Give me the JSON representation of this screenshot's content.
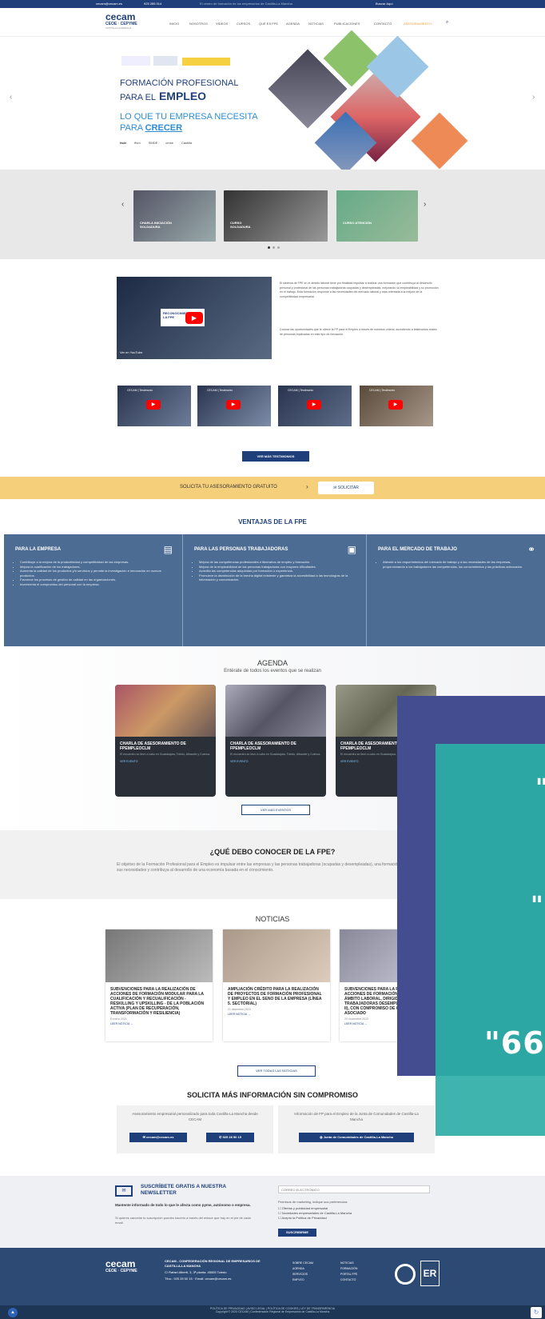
{
  "topbar": {
    "email": "cecam@cecam.es",
    "phone": "925 285 014",
    "tagline": "El centro de formación de los empresarios de Castilla-La Mancha",
    "search": "Buscar Aquí"
  },
  "header": {
    "logo_main": "cecam",
    "logo_sub": "CEOE · CEPYME",
    "logo_caption": "CASTILLA-LA MANCHA",
    "nav": [
      "INICIO",
      "NOSOTROS",
      "VÍDEOS",
      "CURSOS",
      "QUÉ ES FPE",
      "AGENDA",
      "NOTICIAS",
      "PUBLICACIONES",
      "CONTACTO",
      "ASESORAMIENTO"
    ]
  },
  "hero": {
    "line1": "FORMACIÓN PROFESIONAL",
    "line2a": "PARA EL",
    "line2b": "EMPLEO",
    "line3": "LO QUE TU EMPRESA NECESITA",
    "line4a": "PARA",
    "line4b": "CRECER",
    "partners": [
      "fade",
      "ffcm",
      "SMDE",
      "cmse",
      "Castilla"
    ]
  },
  "carousel": {
    "items": [
      "CHARLA INICIACIÓN SOLDADURA",
      "CURSO SOLDADURA",
      "CURSO ATENCIÓN"
    ]
  },
  "video": {
    "main_title": "RECONOCIMIENTO DE LA FPE",
    "watch_label": "Ver en YouTube",
    "para1": "El sistema de FPE en el ámbito laboral tiene por finalidad impulsar a realizar una formación que contribuya al desarrollo personal y profesional de las personas trabajadoras ocupadas y desempleadas, mejorando su empleabilidad y su promoción en el trabajo. Esta formación responde a las necesidades del mercado laboral y está orientada a la mejora de la competitividad empresarial.",
    "para2": "Conoce las oportunidades que te ofrece la FP para el Empleo a través de nuestros vídeos, accediendo a testimonios reales de personas implicadas en este tipo de formación.",
    "thumbs": [
      "CECAM | Testimonio",
      "CECAM | Testimonio",
      "CECAM | Testimonio",
      "CECAM | Testimonio"
    ],
    "more_button": "VER MÁS TESTIMONIOS"
  },
  "asesoramiento": {
    "label": "SOLICITA TU ASESORAMIENTO GRATUITO",
    "button": "SOLICITAR"
  },
  "ventajas": {
    "title": "VENTAJAS DE LA FPE",
    "cols": [
      {
        "title": "PARA LA EMPRESA",
        "items": [
          "Contribuye a la mejora de la productividad y competitividad de las empresas.",
          "Mejora la cualificación de los trabajadores.",
          "Aumenta la calidad de los productos y/o servicios y permite la investigación e innovación en nuevos productos.",
          "Favorece los procesos de gestión de calidad en las organizaciones.",
          "Incrementa el compromiso del personal con la empresa."
        ]
      },
      {
        "title": "PARA LAS PERSONAS TRABAJADORAS",
        "items": [
          "Mejora de las competencias profesionales e itinerarios de empleo y formación.",
          "Mejora de la empleabilidad de las personas trabajadoras con mayores dificultades.",
          "Acredita las competencias adquiridas por formación o experiencia.",
          "Promueve la disminución de la brecha digital existente y garantiza la accesibilidad a las tecnologías de la información y comunicación."
        ]
      },
      {
        "title": "PARA EL MERCADO DE TRABAJO",
        "items": [
          "Atiende a los requerimientos del mercado de trabajo y a las necesidades de las empresas, proporcionando a los trabajadores las competencias, los conocimientos y las prácticas adecuados."
        ]
      }
    ]
  },
  "agenda": {
    "title": "AGENDA",
    "subtitle": "Entérate de todos los eventos que se realizan",
    "cards": [
      {
        "title": "CHARLA DE ASESORAMIENTO DE FPEMPLEOCLM",
        "text": "El encuentro se llevó a cabo en Guadalajara, Toledo, Albacete y Cuenca.",
        "link": "VER EVENTO"
      },
      {
        "title": "CHARLA DE ASESORAMIENTO DE FPEMPLEOCLM",
        "text": "El encuentro se llevó a cabo en Guadalajara, Toledo, Albacete y Cuenca.",
        "link": "VER EVENTO"
      },
      {
        "title": "CHARLA DE ASESORAMIENTO DE FPEMPLEOCLM",
        "text": "El encuentro se llevó a cabo en Guadalajara, Toledo, Albacete y Cuenca.",
        "link": "VER EVENTO"
      }
    ],
    "more_button": "VER MÁS EVENTOS"
  },
  "conocer": {
    "title": "¿QUÉ DEBO CONOCER DE LA FPE?",
    "text": "El objetivo de la Formación Profesional para el Empleo es impulsar entre las empresas y las personas trabajadoras (ocupadas y desempleadas), una formación que se ajuste a sus necesidades y contribuya al desarrollo de una economía basada en el conocimiento."
  },
  "noticias": {
    "title": "NOTICIAS",
    "cards": [
      {
        "title": "SUBVENCIONES PARA LA REALIZACIÓN DE ACCIONES DE FORMACIÓN MODULAR PARA LA CUALIFICACIÓN Y RECUALIFICACIÓN - RESKILLING Y UPSKILLING - DE LA POBLACIÓN ACTIVA (PLAN DE RECUPERACIÓN, TRANSFORMACIÓN Y RESILIENCIA)",
        "date": "8 enero 2024",
        "link": "LEER NOTICIA →"
      },
      {
        "title": "AMPLIACIÓN CRÉDITO PARA LA REALIZACIÓN DE PROYECTOS DE FORMACIÓN PROFESIONAL Y EMPLEO EN EL SENO DE LA EMPRESA (LÍNEA 5. SECTORIAL)",
        "date": "21 diciembre 2023",
        "link": "LEER NOTICIA →"
      },
      {
        "title": "SUBVENCIONES PARA LA REALIZACIÓN DE ACCIONES DE FORMACIÓN PROFESIONAL EN EL ÁMBITO LABORAL, DIRIGIDAS A PERSONAS TRABAJADORAS DESEMPLEADAS (MODALIDAD II), CON COMPROMISO DE CONTRATACIÓN ASOCIADO",
        "date": "20 noviembre 2023",
        "link": "LEER NOTICIA →"
      }
    ],
    "more_button": "VER TODAS LAS NOTICIAS"
  },
  "solicita": {
    "title": "SOLICITA MÁS INFORMACIÓN SIN COMPROMISO",
    "box1_text": "Asesoramiento empresarial personalizado para toda Castilla-La Mancha desde CECAM",
    "box1_btn1": "cecam@cecam.es",
    "box1_btn2": "925 28 50 15",
    "box2_text": "Información de FP para el Empleo de la Junta de Comunidades de Castilla-La Mancha",
    "box2_btn": "Junta de Comunidades de Castilla-La Mancha"
  },
  "subscribe": {
    "title": "SUSCRÍBETE GRATIS A NUESTRA NEWSLETTER",
    "lead": "Mantente informado de todo lo que le afecta como pyme, autónomo o empresa.",
    "note": "Si quieres cancelar tu suscripción puedes hacerlo a través del enlace que hay en el pie de cada email.",
    "email_placeholder": "CORREO ELECTRÓNICO",
    "prefs_label": "Permisos de marketing, indique sus preferencias",
    "options": [
      "Ofertas y publicidad empresarial",
      "Novedades empresariales de Castilla-La Mancha",
      "Acepto la Política de Privacidad"
    ],
    "button": "SUSCRIBIRME"
  },
  "footer": {
    "org": "CECAM - CONFEDERACIÓN REGIONAL DE EMPRESARIOS DE CASTILLA-LA MANCHA",
    "address": "C/ Rafael Alberti, 3, 3ª planta. 45005 Toledo",
    "contact": "Tfno.: 925 28 50 15 · Email: cecam@cecam.es",
    "links1": [
      "SOBRE CECAM",
      "AGENDA",
      "SERVICIOS",
      "EMPLEO"
    ],
    "links2": [
      "NOTICIAS",
      "FORMACIÓN",
      "PORTAL FPE",
      "CONTACTO"
    ]
  },
  "bottom": {
    "legal": "POLÍTICA DE PRIVACIDAD | AVISO LEGAL | POLÍTICA DE COOKIES | LEY DE TRANSPARENCIA",
    "copyright": "Copyright © 2023 CECAM | Confederación Regional de Empresarios de Castilla-La Mancha"
  },
  "overlay": {
    "quote1": "\"",
    "quote2": "\"",
    "number": "\"66"
  },
  "colors": {
    "brand": "#1f3f7a",
    "accent": "#2d8cd6",
    "yellow": "#f6cf7b",
    "ventajas": "#4d6c93",
    "overlay_purple": "#434d8f",
    "overlay_teal": "#2da7a3"
  }
}
